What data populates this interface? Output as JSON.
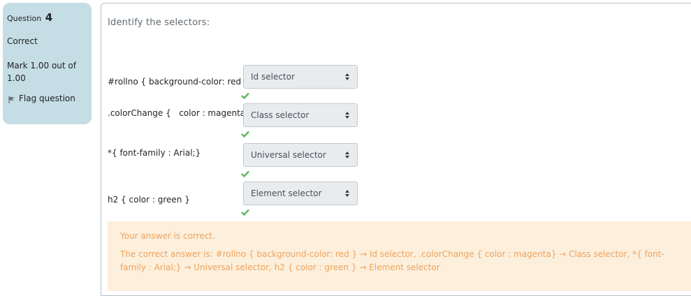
{
  "info": {
    "question_label": "Question",
    "question_number": "4",
    "state": "Correct",
    "grade": "Mark 1.00 out of 1.00",
    "flag_label": "Flag question"
  },
  "question": {
    "text": "Identify the selectors:",
    "rows": [
      {
        "label": "#rollno { background-color: red }",
        "selected": "Id selector"
      },
      {
        "label": ".colorChange {   color : magenta}",
        "selected": "Class selector"
      },
      {
        "label": "*{ font-family : Arial;}",
        "selected": "Universal selector"
      },
      {
        "label": "h2 { color : green }",
        "selected": "Element selector"
      }
    ]
  },
  "feedback": {
    "status": "Your answer is correct.",
    "right_answer": "The correct answer is: #rollno { background-color: red } → Id selector, .colorChange {   color : magenta} → Class selector, *{ font-family : Arial;} → Universal selector, h2 { color : green } → Element selector"
  },
  "colors": {
    "info_bg": "#c5dde4",
    "check": "#5cb85c",
    "feedback_bg": "#fcefdc",
    "feedback_text": "#f0a35b"
  },
  "icons": {
    "flag": "flag-icon",
    "check": "check-icon",
    "select_arrows": "sort-arrows-icon"
  }
}
